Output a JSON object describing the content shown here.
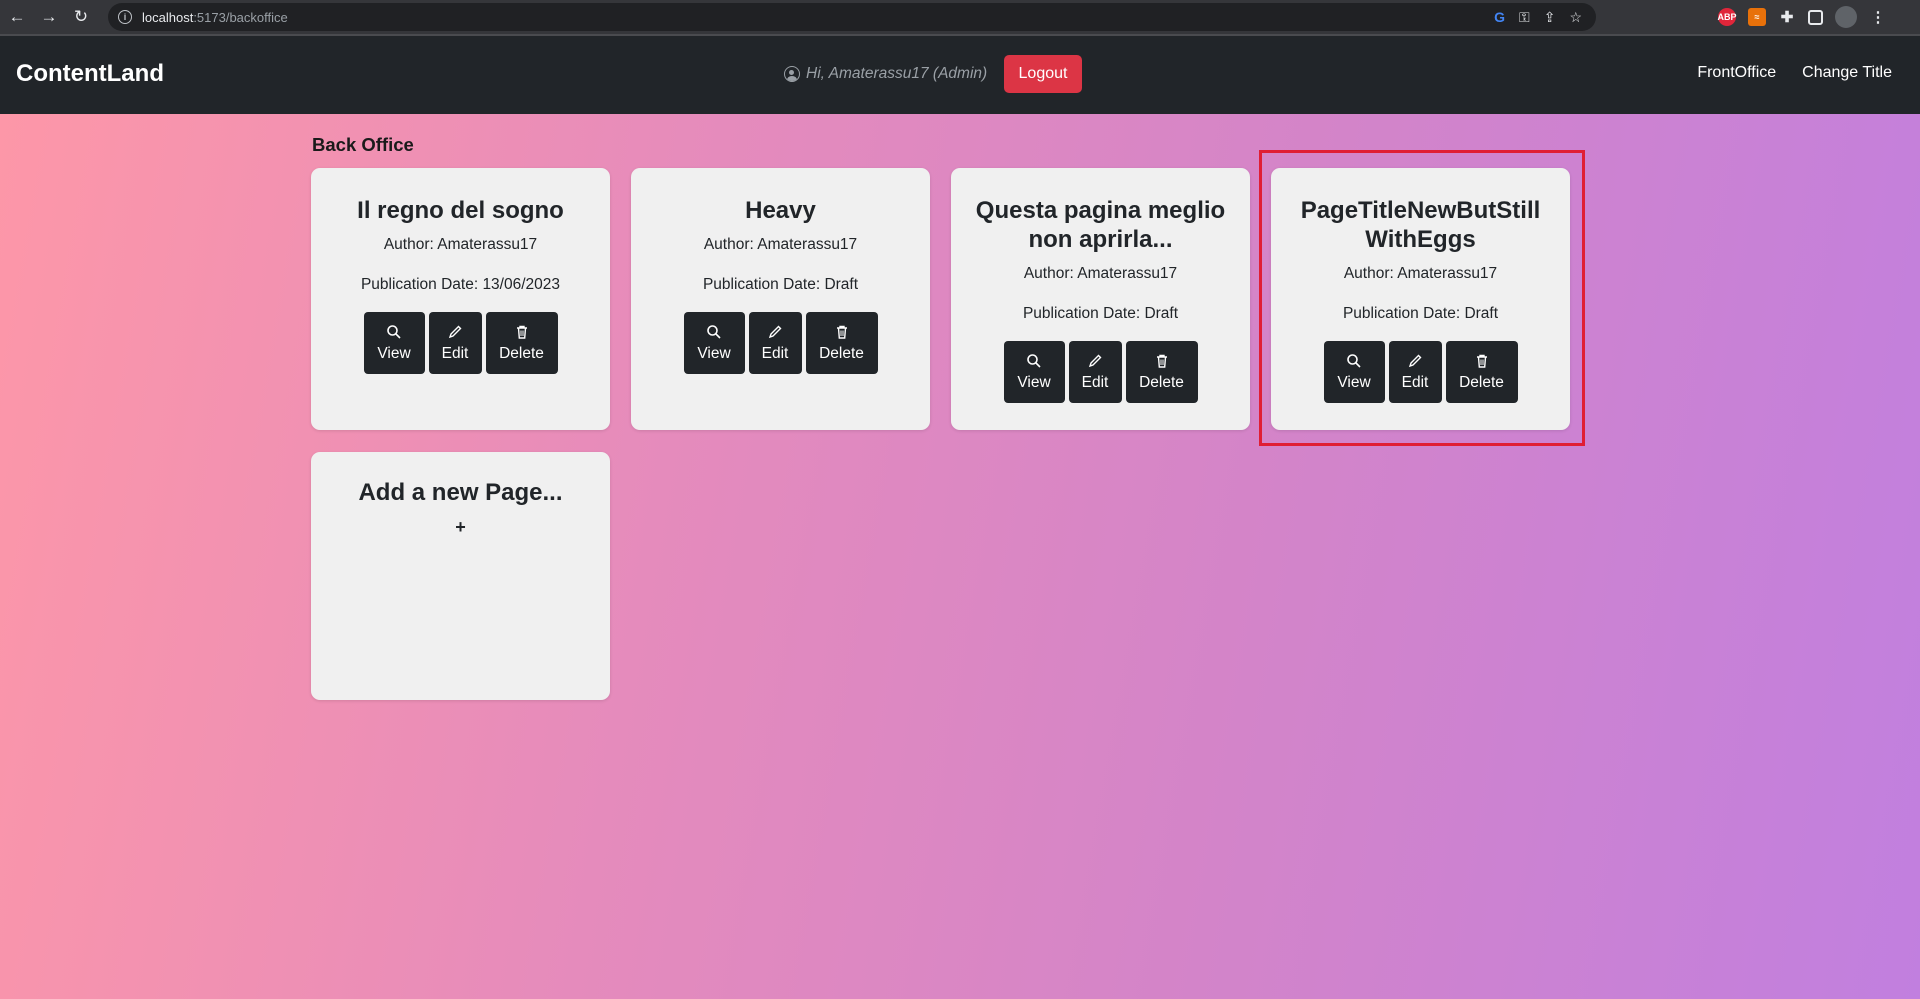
{
  "browser": {
    "url_host": "localhost",
    "url_path": ":5173/backoffice"
  },
  "navbar": {
    "brand": "ContentLand",
    "greeting": "Hi, Amaterassu17 (Admin)",
    "logout_label": "Logout",
    "links": [
      "FrontOffice",
      "Change Title"
    ]
  },
  "main": {
    "section_title": "Back Office",
    "cards": [
      {
        "title": "Il regno del sogno",
        "author": "Author: Amaterassu17",
        "date": "Publication Date: 13/06/2023"
      },
      {
        "title": "Heavy",
        "author": "Author: Amaterassu17",
        "date": "Publication Date: Draft"
      },
      {
        "title": "Questa pagina meglio non aprirla...",
        "author": "Author: Amaterassu17",
        "date": "Publication Date: Draft"
      },
      {
        "title": "PageTitleNewButStill WithEggs",
        "author": "Author: Amaterassu17",
        "date": "Publication Date: Draft"
      }
    ],
    "actions": {
      "view": "View",
      "edit": "Edit",
      "delete": "Delete"
    },
    "add_card": {
      "title": "Add a new Page...",
      "plus": "+"
    }
  },
  "colors": {
    "navbar_bg": "#212529",
    "logout_bg": "#dc3545",
    "highlight_border": "#e01e34",
    "gradient_start": "#fd97a8",
    "gradient_end": "#c17fdf"
  }
}
